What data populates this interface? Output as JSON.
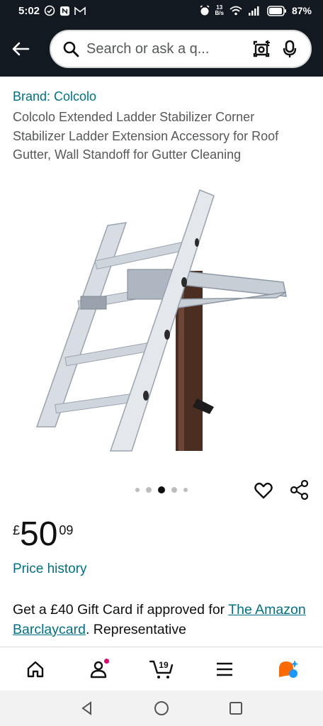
{
  "status_bar": {
    "time": "5:02",
    "net_speed_value": "13",
    "net_speed_unit": "B/s",
    "battery": "87%"
  },
  "header": {
    "search_placeholder": "Search or ask a q..."
  },
  "product": {
    "brand": "Brand: Colcolo",
    "title": "Colcolo Extended Ladder Stabilizer Corner Stabilizer Ladder Extension Accessory for Roof Gutter, Wall Standoff for Gutter Cleaning",
    "image_count": 5,
    "active_image_index": 2,
    "price_currency": "£",
    "price_whole": "50",
    "price_fraction": "09",
    "price_history_label": "Price history"
  },
  "offer": {
    "text_before": "Get a £40 Gift Card if approved for ",
    "link_text": "The Amazon Barclaycard",
    "text_after": ". Representative"
  },
  "bottom_nav": {
    "cart_count": "19",
    "items": [
      "home-icon",
      "account-icon",
      "cart-icon",
      "menu-icon",
      "rufus-icon"
    ]
  },
  "colors": {
    "header_bg": "#131921",
    "link": "#007185",
    "badge": "#e3006f",
    "rufus_orange": "#ff6a00",
    "rufus_blue": "#1a98ff"
  }
}
